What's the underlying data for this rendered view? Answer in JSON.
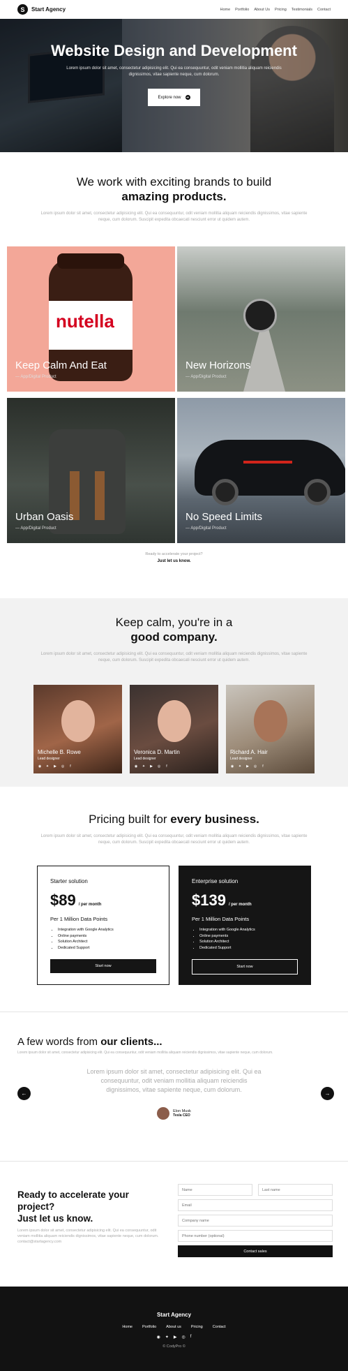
{
  "nav": {
    "brand": "Start Agency",
    "logo_letter": "S",
    "items": [
      "Home",
      "Portfolio",
      "About Us",
      "Pricing",
      "Testimonials",
      "Contact"
    ]
  },
  "hero": {
    "title": "Website Design and Development",
    "text": "Lorem ipsum dolor sit amet, consectetur adipisicing elit. Qui ea consequuntur, odit veniam mollitia aliquam reiciendis dignissimos, vitae sapiente neque, cum dolorum.",
    "button": "Explore now"
  },
  "portfolio": {
    "title_light": "We work with exciting brands to build",
    "title_bold": "amazing products.",
    "text": "Lorem ipsum dolor sit amet, consectetur adipisicing elit. Qui ea consequuntur, odit veniam mollitia aliquam reiciendis dignissimos, vitae sapiente neque, cum dolorum. Suscipit expedita obcaecati nesciunt error ut quidem autem.",
    "items": [
      {
        "name": "Keep Calm And Eat",
        "sub": "— App/Digital Product",
        "jar_text": "nutella"
      },
      {
        "name": "New Horizons",
        "sub": "— App/Digital Product"
      },
      {
        "name": "Urban Oasis",
        "sub": "— App/Digital Product"
      },
      {
        "name": "No Speed Limits",
        "sub": "— App/Digital Product"
      }
    ],
    "cta_question": "Ready to accelerate your project?",
    "cta_bold": "Just let us know."
  },
  "team": {
    "title_light": "Keep calm, you're in a",
    "title_bold": "good company.",
    "text": "Lorem ipsum dolor sit amet, consectetur adipisicing elit. Qui ea consequuntur, odit veniam mollitia aliquam reiciendis dignissimos, vitae sapiente neque, cum dolorum. Suscipit expedita obcaecati nesciunt error ut quidem autem.",
    "members": [
      {
        "name": "Michelle B. Rowe",
        "role": "Lead designer"
      },
      {
        "name": "Veronica D. Martin",
        "role": "Lead designer"
      },
      {
        "name": "Richard A. Hair",
        "role": "Lead designer"
      }
    ],
    "social_icons": [
      "instagram-icon",
      "twitter-icon",
      "youtube-icon",
      "dribbble-icon",
      "facebook-icon"
    ]
  },
  "pricing": {
    "title_light": "Pricing built for",
    "title_bold": "every business.",
    "text": "Lorem ipsum dolor sit amet, consectetur adipisicing elit. Qui ea consequuntur, odit veniam mollitia aliquam reiciendis dignissimos, vitae sapiente neque, cum dolorum. Suscipit expedita obcaecati nesciunt error ut quidem autem.",
    "plans": [
      {
        "name": "Starter solution",
        "price": "$89",
        "period": "/ per month",
        "points": "Per 1 Million Data Points",
        "features": [
          "Integration with Google Analytics",
          "Online payments",
          "Solution Architect",
          "Dedicated Support"
        ],
        "button": "Start now"
      },
      {
        "name": "Enterprise solution",
        "price": "$139",
        "period": "/ per month",
        "points": "Per 1 Million Data Points",
        "features": [
          "Integration with Google Analytics",
          "Online payments",
          "Solution Architect",
          "Dedicated Support"
        ],
        "button": "Start now"
      }
    ]
  },
  "testimonials": {
    "title_light": "A few words from",
    "title_bold": "our clients...",
    "text": "Lorem ipsum dolor sit amet, consectetur adipisicing elit. Qui ea consequuntur, odit veniam mollitia aliquam reiciendis dignissimos, vitae sapiente neque, cum dolorum.",
    "quote": "Lorem ipsum dolor sit amet, consectetur adipisicing elit. Qui ea consequuntur, odit veniam mollitia aliquam reiciendis dignissimos, vitae sapiente neque, cum dolorum.",
    "author_name": "Elon Musk",
    "author_role": "Tesla CEO"
  },
  "contact": {
    "title_1": "Ready to accelerate your project?",
    "title_2": "Just let us know.",
    "text": "Lorem ipsum dolor sit amet, consectetur adipisicing elit. Qui ea consequuntur, odit veniam mollitia aliquam reiciendis dignissimos, vitae sapiente neque, cum dolorum.",
    "email": "contact@startagency.com",
    "placeholders": {
      "name": "Name",
      "lastname": "Last name",
      "email": "Email",
      "company": "Company name",
      "phone": "Phone number (optional)"
    },
    "button": "Contact sales"
  },
  "footer": {
    "brand": "Start Agency",
    "links": [
      "Home",
      "Portfolio",
      "About us",
      "Pricing",
      "Contact"
    ],
    "copyright": "© CodyPro ©"
  }
}
